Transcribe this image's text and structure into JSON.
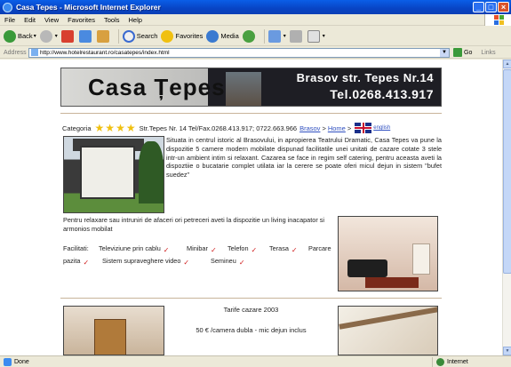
{
  "window": {
    "title": "Casa Tepes - Microsoft Internet Explorer"
  },
  "menu": [
    "File",
    "Edit",
    "View",
    "Favorites",
    "Tools",
    "Help"
  ],
  "toolbar": {
    "back": "Back",
    "search": "Search",
    "favorites": "Favorites",
    "media": "Media"
  },
  "address": {
    "label": "Address",
    "url": "http://www.hotelrestaurant.ro/casatepes/index.html",
    "go": "Go",
    "links": "Links"
  },
  "page": {
    "banner": {
      "brand": "Casa Țepes",
      "address": "Brasov str. Tepes Nr.14",
      "tel": "Tel.0268.413.917"
    },
    "category": {
      "label": "Categoria",
      "stars": 4,
      "star_color": "#f0c010",
      "contact": "Str.Tepes Nr. 14 Tel/Fax.0268.413.917; 0722.663.966",
      "breadcrumb_city": "Brasov",
      "sep": ">",
      "breadcrumb_home": "Home",
      "english": "english"
    },
    "intro": "Situata in centrul istoric al Brasovului, in apropierea Teatrului Dramatic, Casa Tepes va pune la dispozitie 5 camere modern mobilate dispunad facilitatile unei unitati de cazare cotate 3 stele intr-un ambient intim si relaxant. Cazarea se face in regim self catering, pentru aceasta aveti la dispoztiie o bucatarie complet utilata iar la cerere se poate oferi micul dejun in sistem \"bufet suedez\"",
    "relax": "Pentru relaxare sau intruniri de afaceri ori petreceri aveti la dispozitie un living inacapator si armonios mobilat",
    "facilities": {
      "label": "Facilitati:",
      "items": [
        "Televiziune prin cablu",
        "Minibar",
        "Telefon",
        "Terasa",
        "Parcare",
        "pazita",
        "Sistem supraveghere video",
        "Semineu"
      ]
    },
    "tarife": {
      "title": "Tarife cazare 2003",
      "line1": "50 € /camera dubla - mic dejun inclus"
    }
  },
  "status": {
    "text": "Done",
    "zone": "Internet"
  }
}
